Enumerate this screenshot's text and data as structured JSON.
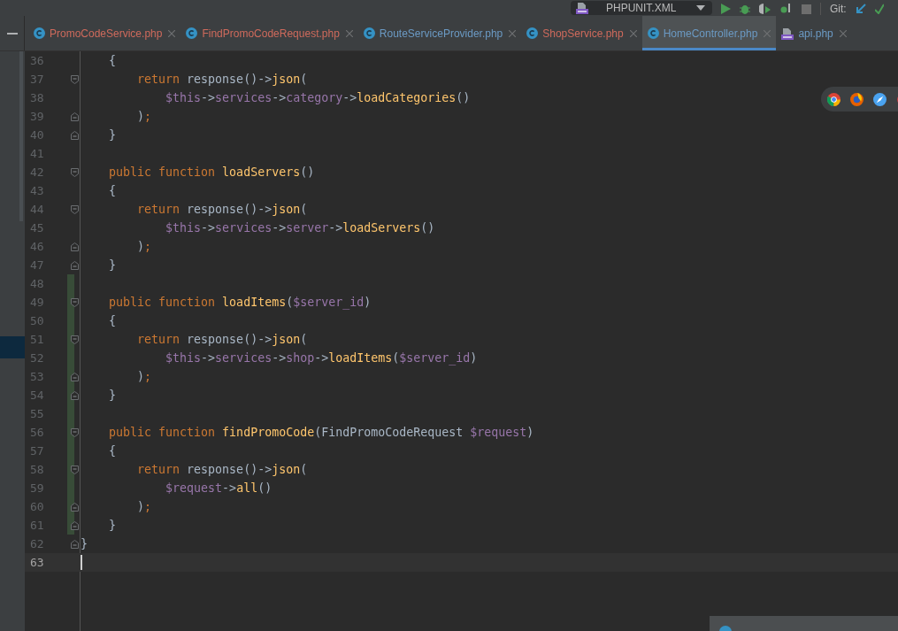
{
  "toolbar": {
    "run_config": "PHPUNIT.XML",
    "vcs_label": "Git:"
  },
  "tabs": [
    {
      "name": "PromoCodeService.php",
      "kind": "class",
      "color": "#cf6a5c",
      "selected": false
    },
    {
      "name": "FindPromoCodeRequest.php",
      "kind": "class",
      "color": "#cf6a5c",
      "selected": false
    },
    {
      "name": "RouteServiceProvider.php",
      "kind": "class",
      "color": "#6b9ac4",
      "selected": false
    },
    {
      "name": "ShopService.php",
      "kind": "class",
      "color": "#cf6a5c",
      "selected": false
    },
    {
      "name": "HomeController.php",
      "kind": "class",
      "color": "#6b9ac4",
      "selected": true
    },
    {
      "name": "api.php",
      "kind": "php",
      "color": "#6b9ac4",
      "selected": false
    }
  ],
  "editor": {
    "lines": [
      {
        "number": "36",
        "current": false,
        "changed": false,
        "fold_start": false,
        "fold_end": false,
        "tokens": [
          {
            "kind": "plain",
            "text": "    {"
          }
        ]
      },
      {
        "number": "37",
        "current": false,
        "changed": false,
        "fold_start": true,
        "fold_end": false,
        "tokens": [
          {
            "kind": "keyword",
            "text": "        return"
          },
          {
            "kind": "plain",
            "text": " response()->"
          },
          {
            "kind": "method",
            "text": "json"
          },
          {
            "kind": "plain",
            "text": "("
          }
        ]
      },
      {
        "number": "38",
        "current": false,
        "changed": false,
        "fold_start": false,
        "fold_end": false,
        "tokens": [
          {
            "kind": "var",
            "text": "            $this"
          },
          {
            "kind": "plain",
            "text": "->"
          },
          {
            "kind": "prop",
            "text": "services"
          },
          {
            "kind": "plain",
            "text": "->"
          },
          {
            "kind": "prop",
            "text": "category"
          },
          {
            "kind": "plain",
            "text": "->"
          },
          {
            "kind": "method",
            "text": "loadCategories"
          },
          {
            "kind": "plain",
            "text": "()"
          }
        ]
      },
      {
        "number": "39",
        "current": false,
        "changed": false,
        "fold_start": false,
        "fold_end": true,
        "tokens": [
          {
            "kind": "plain",
            "text": "        )"
          },
          {
            "kind": "keyword",
            "text": ";"
          }
        ]
      },
      {
        "number": "40",
        "current": false,
        "changed": false,
        "fold_start": false,
        "fold_end": true,
        "tokens": [
          {
            "kind": "plain",
            "text": "    }"
          }
        ]
      },
      {
        "number": "41",
        "current": false,
        "changed": false,
        "fold_start": false,
        "fold_end": false
      },
      {
        "number": "42",
        "current": false,
        "changed": false,
        "fold_start": true,
        "fold_end": false,
        "tokens": [
          {
            "kind": "keyword",
            "text": "    public function "
          },
          {
            "kind": "method",
            "text": "loadServers"
          },
          {
            "kind": "plain",
            "text": "()"
          }
        ]
      },
      {
        "number": "43",
        "current": false,
        "changed": false,
        "fold_start": false,
        "fold_end": false,
        "tokens": [
          {
            "kind": "plain",
            "text": "    {"
          }
        ]
      },
      {
        "number": "44",
        "current": false,
        "changed": false,
        "fold_start": true,
        "fold_end": false,
        "tokens": [
          {
            "kind": "keyword",
            "text": "        return"
          },
          {
            "kind": "plain",
            "text": " response()->"
          },
          {
            "kind": "method",
            "text": "json"
          },
          {
            "kind": "plain",
            "text": "("
          }
        ]
      },
      {
        "number": "45",
        "current": false,
        "changed": false,
        "fold_start": false,
        "fold_end": false,
        "tokens": [
          {
            "kind": "var",
            "text": "            $this"
          },
          {
            "kind": "plain",
            "text": "->"
          },
          {
            "kind": "prop",
            "text": "services"
          },
          {
            "kind": "plain",
            "text": "->"
          },
          {
            "kind": "prop",
            "text": "server"
          },
          {
            "kind": "plain",
            "text": "->"
          },
          {
            "kind": "method",
            "text": "loadServers"
          },
          {
            "kind": "plain",
            "text": "()"
          }
        ]
      },
      {
        "number": "46",
        "current": false,
        "changed": false,
        "fold_start": false,
        "fold_end": true,
        "tokens": [
          {
            "kind": "plain",
            "text": "        )"
          },
          {
            "kind": "keyword",
            "text": ";"
          }
        ]
      },
      {
        "number": "47",
        "current": false,
        "changed": false,
        "fold_start": false,
        "fold_end": true,
        "tokens": [
          {
            "kind": "plain",
            "text": "    }"
          }
        ]
      },
      {
        "number": "48",
        "current": false,
        "changed": true,
        "fold_start": false,
        "fold_end": false
      },
      {
        "number": "49",
        "current": false,
        "changed": true,
        "fold_start": true,
        "fold_end": false,
        "tokens": [
          {
            "kind": "keyword",
            "text": "    public function "
          },
          {
            "kind": "method",
            "text": "loadItems"
          },
          {
            "kind": "plain",
            "text": "("
          },
          {
            "kind": "var",
            "text": "$server_id"
          },
          {
            "kind": "plain",
            "text": ")"
          }
        ]
      },
      {
        "number": "50",
        "current": false,
        "changed": true,
        "fold_start": false,
        "fold_end": false,
        "tokens": [
          {
            "kind": "plain",
            "text": "    {"
          }
        ]
      },
      {
        "number": "51",
        "current": false,
        "changed": true,
        "fold_start": true,
        "fold_end": false,
        "tokens": [
          {
            "kind": "keyword",
            "text": "        return"
          },
          {
            "kind": "plain",
            "text": " response()->"
          },
          {
            "kind": "method",
            "text": "json"
          },
          {
            "kind": "plain",
            "text": "("
          }
        ]
      },
      {
        "number": "52",
        "current": false,
        "changed": true,
        "fold_start": false,
        "fold_end": false,
        "tokens": [
          {
            "kind": "var",
            "text": "            $this"
          },
          {
            "kind": "plain",
            "text": "->"
          },
          {
            "kind": "prop",
            "text": "services"
          },
          {
            "kind": "plain",
            "text": "->"
          },
          {
            "kind": "prop",
            "text": "shop"
          },
          {
            "kind": "plain",
            "text": "->"
          },
          {
            "kind": "method",
            "text": "loadItems"
          },
          {
            "kind": "plain",
            "text": "("
          },
          {
            "kind": "var",
            "text": "$server_id"
          },
          {
            "kind": "plain",
            "text": ")"
          }
        ]
      },
      {
        "number": "53",
        "current": false,
        "changed": true,
        "fold_start": false,
        "fold_end": true,
        "tokens": [
          {
            "kind": "plain",
            "text": "        )"
          },
          {
            "kind": "keyword",
            "text": ";"
          }
        ]
      },
      {
        "number": "54",
        "current": false,
        "changed": true,
        "fold_start": false,
        "fold_end": true,
        "tokens": [
          {
            "kind": "plain",
            "text": "    }"
          }
        ]
      },
      {
        "number": "55",
        "current": false,
        "changed": true,
        "fold_start": false,
        "fold_end": false
      },
      {
        "number": "56",
        "current": false,
        "changed": true,
        "fold_start": true,
        "fold_end": false,
        "tokens": [
          {
            "kind": "keyword",
            "text": "    public function "
          },
          {
            "kind": "method",
            "text": "findPromoCode"
          },
          {
            "kind": "plain",
            "text": "(FindPromoCodeRequest "
          },
          {
            "kind": "var",
            "text": "$request"
          },
          {
            "kind": "plain",
            "text": ")"
          }
        ]
      },
      {
        "number": "57",
        "current": false,
        "changed": true,
        "fold_start": false,
        "fold_end": false,
        "tokens": [
          {
            "kind": "plain",
            "text": "    {"
          }
        ]
      },
      {
        "number": "58",
        "current": false,
        "changed": true,
        "fold_start": true,
        "fold_end": false,
        "tokens": [
          {
            "kind": "keyword",
            "text": "        return"
          },
          {
            "kind": "plain",
            "text": " response()->"
          },
          {
            "kind": "method",
            "text": "json"
          },
          {
            "kind": "plain",
            "text": "("
          }
        ]
      },
      {
        "number": "59",
        "current": false,
        "changed": true,
        "fold_start": false,
        "fold_end": false,
        "tokens": [
          {
            "kind": "var",
            "text": "            $request"
          },
          {
            "kind": "plain",
            "text": "->"
          },
          {
            "kind": "method",
            "text": "all"
          },
          {
            "kind": "plain",
            "text": "()"
          }
        ]
      },
      {
        "number": "60",
        "current": false,
        "changed": true,
        "fold_start": false,
        "fold_end": true,
        "tokens": [
          {
            "kind": "plain",
            "text": "        )"
          },
          {
            "kind": "keyword",
            "text": ";"
          }
        ]
      },
      {
        "number": "61",
        "current": false,
        "changed": true,
        "fold_start": false,
        "fold_end": true,
        "tokens": [
          {
            "kind": "plain",
            "text": "    }"
          }
        ]
      },
      {
        "number": "62",
        "current": false,
        "changed": false,
        "fold_start": false,
        "fold_end": true,
        "tokens": [
          {
            "kind": "plain",
            "text": "}"
          }
        ]
      },
      {
        "number": "63",
        "current": true,
        "changed": false,
        "fold_start": false,
        "fold_end": false
      }
    ]
  }
}
